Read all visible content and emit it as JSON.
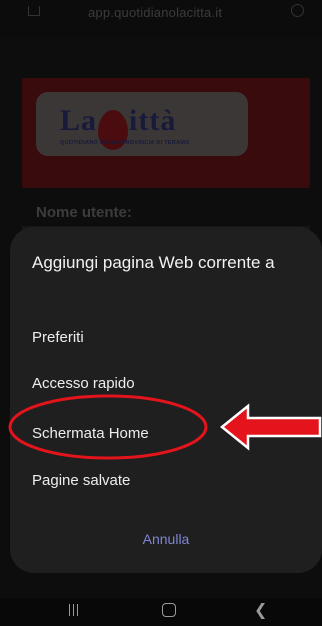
{
  "browser": {
    "url": "app.quotidianolacitta.it"
  },
  "page": {
    "logo": {
      "text_left": "La",
      "text_c": "C",
      "text_right": "ittà",
      "tagline": "QUOTIDIANO DELLA PROVINCIA DI TERAMO"
    },
    "username_label": "Nome utente:"
  },
  "sheet": {
    "title": "Aggiungi pagina Web corrente a",
    "items": [
      {
        "label": "Preferiti"
      },
      {
        "label": "Accesso rapido"
      },
      {
        "label": "Schermata Home"
      },
      {
        "label": "Pagine salvate"
      }
    ],
    "cancel_label": "Annulla"
  },
  "annotation": {
    "highlight_color": "#e3141b",
    "highlighted_item": "Schermata Home"
  },
  "navbar": {
    "icons": [
      "recents-icon",
      "home-icon",
      "back-icon"
    ]
  },
  "colors": {
    "sheet_bg": "#1f1f1f",
    "accent_text": "#7e85d3"
  }
}
